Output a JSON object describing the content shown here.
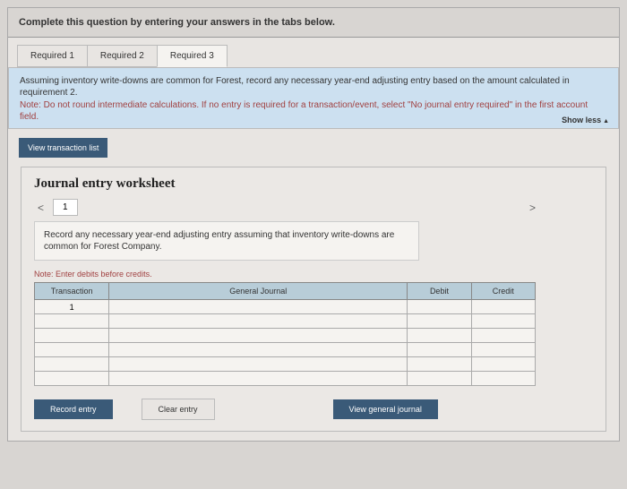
{
  "header": {
    "instruction": "Complete this question by entering your answers in the tabs below."
  },
  "tabs": {
    "t1": "Required 1",
    "t2": "Required 2",
    "t3": "Required 3"
  },
  "note": {
    "line1": "Assuming inventory write-downs are common for Forest, record any necessary year-end adjusting entry based on the amount calculated in requirement 2.",
    "line2": "Note: Do not round intermediate calculations. If no entry is required for a transaction/event, select \"No journal entry required\" in the first account field.",
    "showless": "Show less"
  },
  "buttons": {
    "vtl": "View transaction list",
    "record": "Record entry",
    "clear": "Clear entry",
    "vgj": "View general journal"
  },
  "worksheet": {
    "title": "Journal entry worksheet",
    "navtab": "1",
    "desc": "Record any necessary year-end adjusting entry assuming that inventory write-downs are common for Forest Company.",
    "notered": "Note: Enter debits before credits.",
    "cols": {
      "trans": "Transaction",
      "gj": "General Journal",
      "debit": "Debit",
      "credit": "Credit"
    },
    "row1trans": "1"
  }
}
